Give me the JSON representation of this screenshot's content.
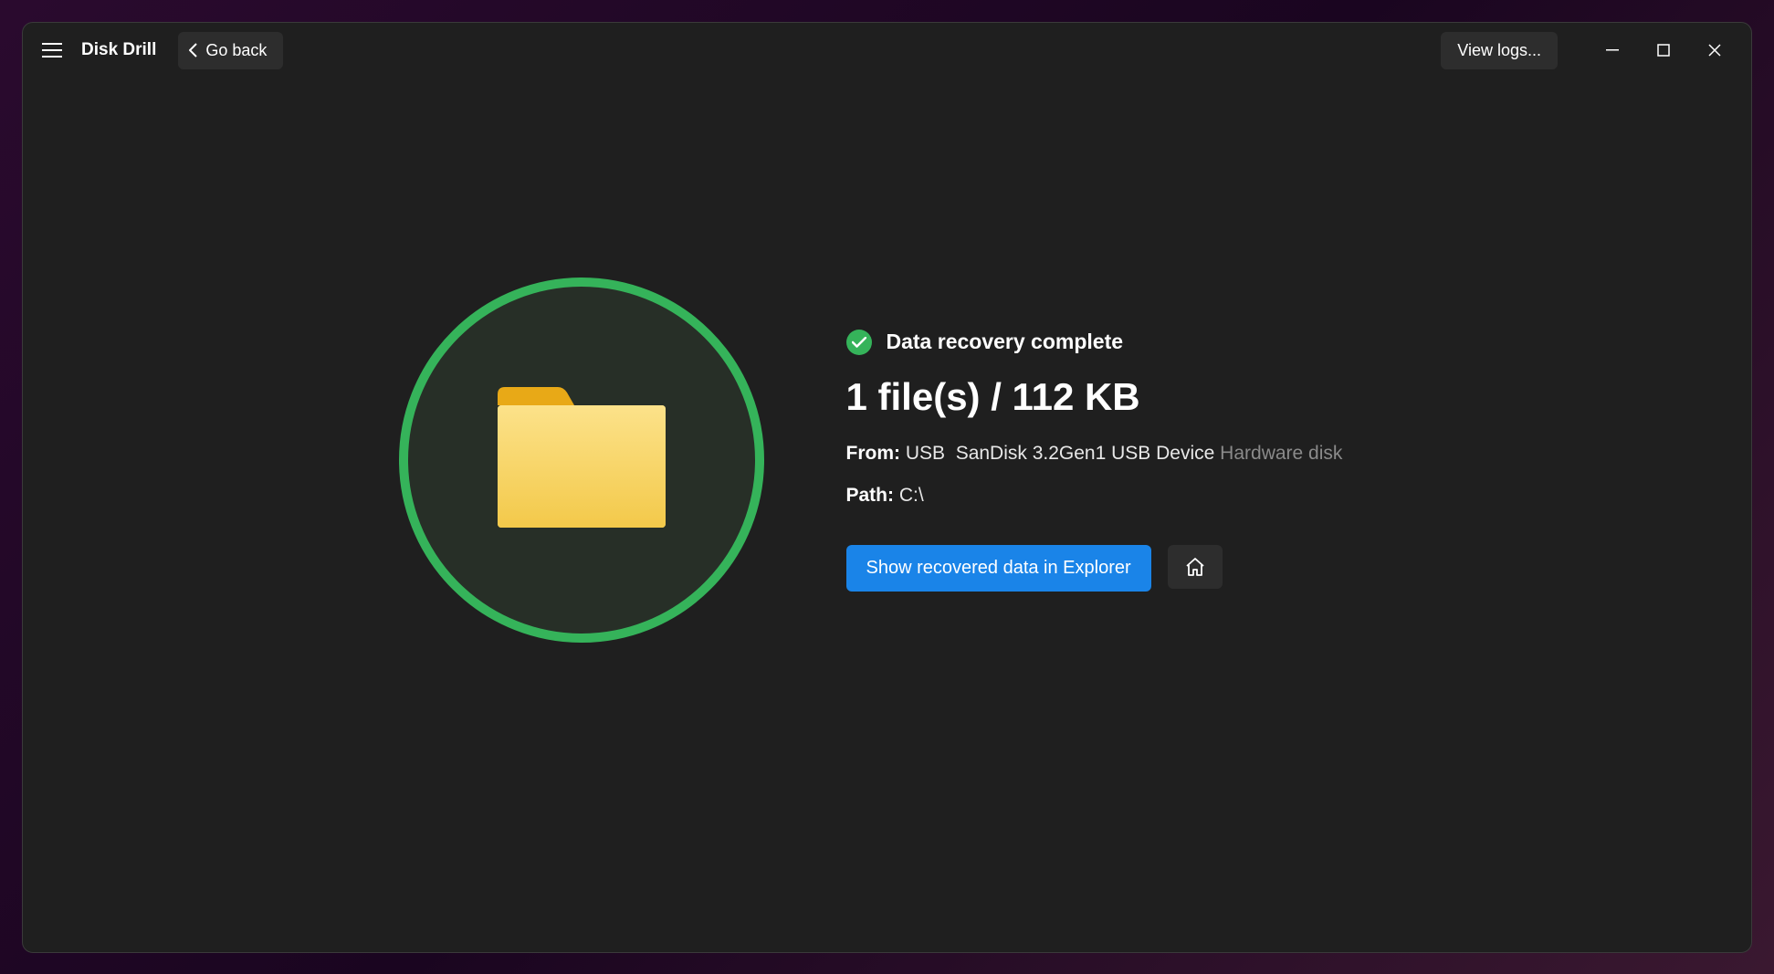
{
  "app": {
    "title": "Disk Drill"
  },
  "toolbar": {
    "back_label": "Go back",
    "logs_label": "View logs..."
  },
  "result": {
    "status_text": "Data recovery complete",
    "headline": "1 file(s) / 112 KB",
    "from_label": "From:",
    "from_interface": "USB",
    "from_device": "SanDisk 3.2Gen1 USB Device",
    "from_type": "Hardware disk",
    "path_label": "Path:",
    "path_value": "C:\\",
    "show_button": "Show recovered data in Explorer"
  },
  "colors": {
    "accent_green": "#35b35a",
    "accent_blue": "#1a84e8"
  }
}
